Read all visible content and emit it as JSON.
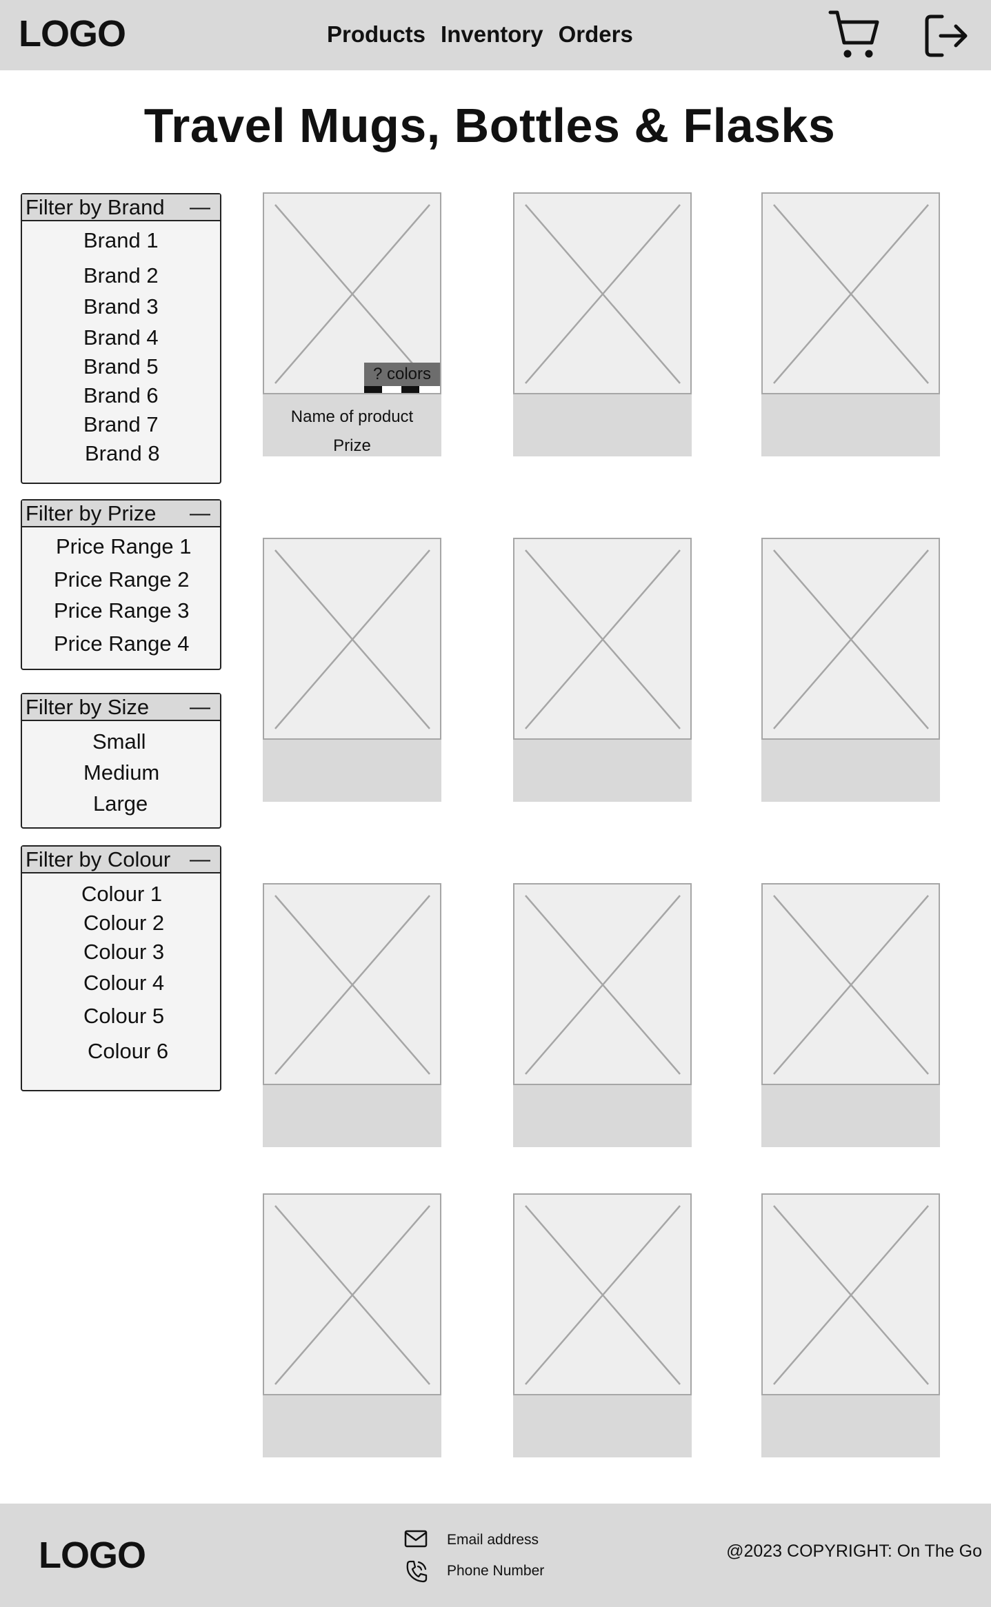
{
  "header": {
    "logo": "LOGO",
    "nav": [
      "Products",
      "Inventory",
      "Orders"
    ],
    "cart_icon": "shopping-cart-icon",
    "logout_icon": "logout-icon"
  },
  "page_title": "Travel Mugs, Bottles & Flasks",
  "filters": {
    "brand": {
      "title": "Filter by Brand",
      "collapse": "—",
      "items": [
        "Brand 1",
        "Brand 2",
        "Brand 3",
        "Brand 4",
        "Brand 5",
        "Brand 6",
        "Brand 7",
        "Brand 8"
      ]
    },
    "price": {
      "title": "Filter by Prize",
      "collapse": "—",
      "items": [
        "Price Range 1",
        "Price Range 2",
        "Price Range 3",
        "Price Range 4"
      ]
    },
    "size": {
      "title": "Filter by Size",
      "collapse": "—",
      "items": [
        "Small",
        "Medium",
        "Large"
      ]
    },
    "colour": {
      "title": "Filter by Colour",
      "collapse": "—",
      "items": [
        "Colour 1",
        "Colour 2",
        "Colour 3",
        "Colour 4",
        "Colour 5",
        "Colour 6"
      ]
    }
  },
  "product_card": {
    "colors_badge": "? colors",
    "name": "Name of product",
    "price": "Prize",
    "image_placeholder": "image-placeholder-icon"
  },
  "footer": {
    "logo": "LOGO",
    "email_icon": "mail-icon",
    "phone_icon": "phone-icon",
    "email": "Email address",
    "phone": "Phone Number",
    "copyright": "@2023 COPYRIGHT: On The Go"
  },
  "colors": {
    "header_bg": "#d9d9d9",
    "placeholder_bg": "#eeeeee",
    "placeholder_stroke": "#a6a6a6",
    "badge_bg": "#6d6d6d"
  }
}
